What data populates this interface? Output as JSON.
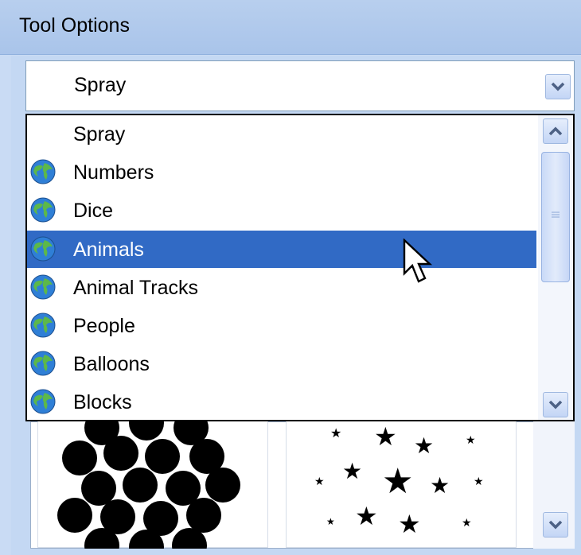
{
  "panel": {
    "title": "Tool Options"
  },
  "combo": {
    "value": "Spray",
    "open": true
  },
  "dropdown": {
    "items": [
      {
        "label": "Spray",
        "icon": "none"
      },
      {
        "label": "Numbers",
        "icon": "globe-icon"
      },
      {
        "label": "Dice",
        "icon": "globe-icon"
      },
      {
        "label": "Animals",
        "icon": "globe-icon"
      },
      {
        "label": "Animal Tracks",
        "icon": "globe-icon"
      },
      {
        "label": "People",
        "icon": "globe-icon"
      },
      {
        "label": "Balloons",
        "icon": "globe-icon"
      },
      {
        "label": "Blocks",
        "icon": "globe-icon"
      }
    ],
    "highlighted": "Animals"
  },
  "gallery": {
    "tiles": [
      "circles-brush",
      "stars-brush"
    ]
  },
  "colors": {
    "selection": "#316ac5",
    "header": "#b8cfee",
    "panel": "#c4d8f3"
  }
}
